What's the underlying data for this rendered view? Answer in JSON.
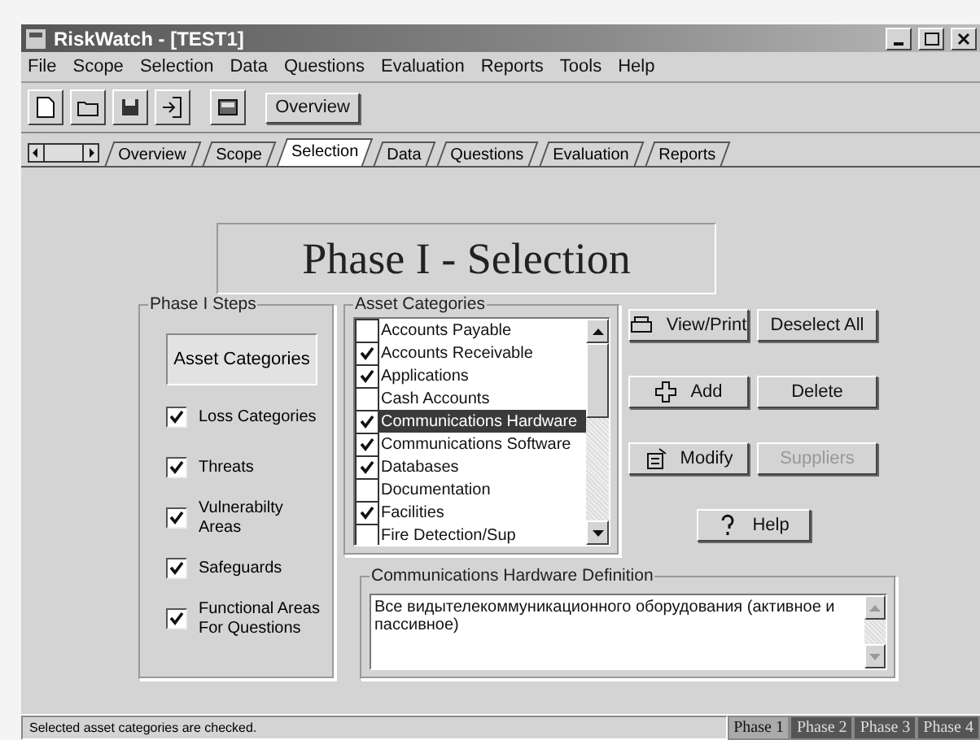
{
  "window": {
    "title": "RiskWatch - [TEST1]"
  },
  "menu": [
    "File",
    "Scope",
    "Selection",
    "Data",
    "Questions",
    "Evaluation",
    "Reports",
    "Tools",
    "Help"
  ],
  "toolbar": {
    "overview_button": "Overview"
  },
  "tabs": [
    {
      "label": "Overview",
      "selected": false
    },
    {
      "label": "Scope",
      "selected": false
    },
    {
      "label": "Selection",
      "selected": true
    },
    {
      "label": "Data",
      "selected": false
    },
    {
      "label": "Questions",
      "selected": false
    },
    {
      "label": "Evaluation",
      "selected": false
    },
    {
      "label": "Reports",
      "selected": false
    }
  ],
  "phase_title": "Phase I - Selection",
  "steps": {
    "title": "Phase I Steps",
    "items": [
      {
        "kind": "button",
        "label": "Asset Categories"
      },
      {
        "kind": "check",
        "label": "Loss Categories",
        "checked": true
      },
      {
        "kind": "check",
        "label": "Threats",
        "checked": true
      },
      {
        "kind": "check",
        "label": "Vulnerabilty Areas",
        "checked": true
      },
      {
        "kind": "check",
        "label": "Safeguards",
        "checked": true
      },
      {
        "kind": "check",
        "label": "Functional Areas For Questions",
        "checked": true
      }
    ]
  },
  "assets": {
    "title": "Asset Categories",
    "items": [
      {
        "label": "Accounts Payable",
        "checked": false,
        "selected": false
      },
      {
        "label": "Accounts Receivable",
        "checked": true,
        "selected": false
      },
      {
        "label": "Applications",
        "checked": true,
        "selected": false
      },
      {
        "label": "Cash Accounts",
        "checked": false,
        "selected": false
      },
      {
        "label": "Communications Hardware",
        "checked": true,
        "selected": true
      },
      {
        "label": "Communications Software",
        "checked": true,
        "selected": false
      },
      {
        "label": "Databases",
        "checked": true,
        "selected": false
      },
      {
        "label": "Documentation",
        "checked": false,
        "selected": false
      },
      {
        "label": "Facilities",
        "checked": true,
        "selected": false
      },
      {
        "label": "Fire Detection/Sup",
        "checked": false,
        "selected": false
      }
    ]
  },
  "buttons": [
    {
      "kind": "print",
      "label": "View/Print",
      "disabled": false
    },
    {
      "kind": "plain",
      "label": "Deselect All",
      "disabled": false
    },
    {
      "kind": "add",
      "label": "Add",
      "disabled": false
    },
    {
      "kind": "plain",
      "label": "Delete",
      "disabled": false
    },
    {
      "kind": "modify",
      "label": "Modify",
      "disabled": false
    },
    {
      "kind": "plain",
      "label": "Suppliers",
      "disabled": true
    },
    {
      "kind": "help",
      "label": "Help",
      "disabled": false
    }
  ],
  "definition": {
    "title": "Communications Hardware Definition",
    "value": "Все видытелекоммуникационного оборудования (активное и пассивное)"
  },
  "status_bar": {
    "text": "Selected asset categories are checked.",
    "phases": [
      {
        "label": "Phase 1",
        "selected": true
      },
      {
        "label": "Phase 2",
        "selected": false
      },
      {
        "label": "Phase 3",
        "selected": false
      },
      {
        "label": "Phase 4",
        "selected": false
      }
    ]
  }
}
